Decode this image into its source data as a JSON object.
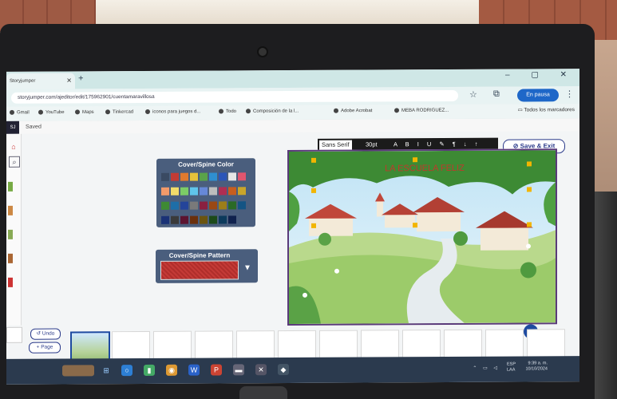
{
  "browser": {
    "tab_title": "Storyjumper",
    "url": "storyjumper.com/ajeditor/edit/175962901/cuentamaravillosa",
    "pause_label": "En pausa",
    "bookmarks": [
      {
        "label": "Gmail"
      },
      {
        "label": "YouTube"
      },
      {
        "label": "Maps"
      },
      {
        "label": "Tinkercad"
      },
      {
        "label": "iconos para juegos d..."
      },
      {
        "label": "Todo"
      },
      {
        "label": "Composición de la l..."
      },
      {
        "label": "Adobe Acrobat"
      },
      {
        "label": "MEBA RODRIGUEZ..."
      }
    ],
    "bookmarks_folder": "Todos los marcadores"
  },
  "editor": {
    "logo": "SJ",
    "saved_status": "Saved",
    "save_exit_label": "Save & Exit",
    "toolbar": {
      "font": "Sans Serif",
      "size": "30pt",
      "tools": "A B I U ✎ ¶ ↓ ↑"
    },
    "cover_color_title": "Cover/Spine Color",
    "cover_pattern_title": "Cover/Spine Pattern",
    "swatch_colors": [
      "#3a4a62",
      "#c23b34",
      "#e07a2e",
      "#e7c23a",
      "#5aa34a",
      "#2f8fd0",
      "#2b55b8",
      "#e6e6e6",
      "#e0556e",
      "#f29a6a",
      "#f2dc6a",
      "#7ccc66",
      "#5fc4ea",
      "#6688d8",
      "#bdbdbd",
      "#b02e52",
      "#c85e1e",
      "#c9a52a",
      "#3e8a34",
      "#1e6ea8",
      "#24449a",
      "#7a7a7a",
      "#8a2040",
      "#9a4814",
      "#9c7e1a",
      "#2a6a26",
      "#145484",
      "#1a3276",
      "#3a3a3a",
      "#5c1430",
      "#6a300c",
      "#6a5410",
      "#1c4a1a",
      "#0c3a5c",
      "#10224e"
    ],
    "cover_title": "LA ESCUELA FELIZ",
    "undo_label": "Undo",
    "add_page_label": "+ Page"
  },
  "taskbar": {
    "lang": "ESP\nLAA",
    "time": "9:39 a. m.",
    "date": "10/10/2024"
  }
}
